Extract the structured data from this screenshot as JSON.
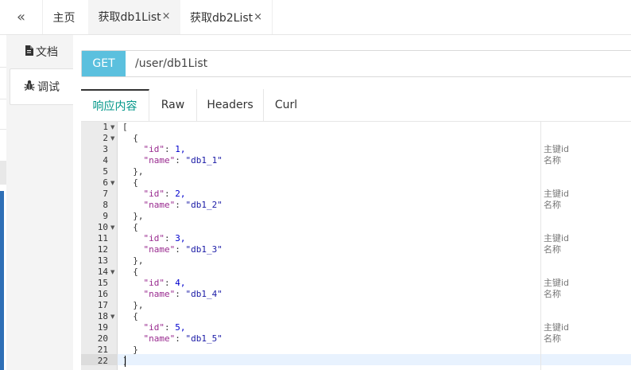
{
  "header": {
    "collapse_icon": "chevrons-left-icon",
    "tabs": [
      {
        "label": "主页",
        "close": ""
      },
      {
        "label": "获取db1List",
        "close": "×"
      },
      {
        "label": "获取db2List",
        "close": "×"
      }
    ]
  },
  "side_tabs": [
    {
      "label": "文档",
      "icon": "document-icon"
    },
    {
      "label": "调试",
      "icon": "bug-icon"
    }
  ],
  "request": {
    "method": "GET",
    "path": "/user/db1List"
  },
  "response_tabs": [
    "响应内容",
    "Raw",
    "Headers",
    "Curl"
  ],
  "editor": {
    "line_numbers": [
      "1",
      "2",
      "3",
      "4",
      "5",
      "6",
      "7",
      "8",
      "9",
      "10",
      "11",
      "12",
      "13",
      "14",
      "15",
      "16",
      "17",
      "18",
      "19",
      "20",
      "21",
      "22"
    ],
    "open_bracket": "[",
    "close_bracket": "]",
    "open_brace": "{",
    "close_brace": "},",
    "last_close_brace": "}",
    "key_id": "\"id\"",
    "key_name": "\"name\"",
    "ids": [
      "1,",
      "2,",
      "3,",
      "4,",
      "5,"
    ],
    "names": [
      "\"db1_1\"",
      "\"db1_2\"",
      "\"db1_3\"",
      "\"db1_4\"",
      "\"db1_5\""
    ],
    "colon": ": ",
    "comment_id": "主键id",
    "comment_name": "名称"
  }
}
